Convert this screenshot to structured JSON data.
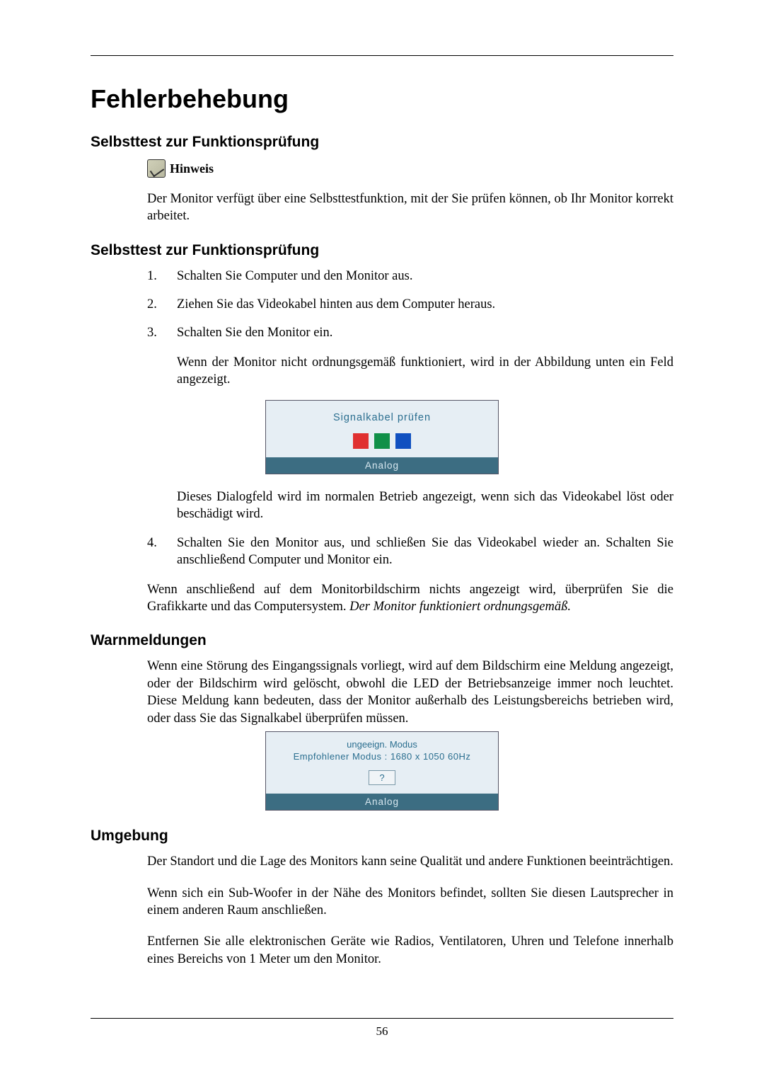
{
  "page_number": "56",
  "title": "Fehlerbehebung",
  "sections": {
    "s1": {
      "heading": "Selbsttest zur Funktionsprüfung",
      "note_label": "Hinweis",
      "note_body": "Der Monitor verfügt über eine Selbsttestfunktion, mit der Sie prüfen können, ob Ihr Monitor korrekt arbeitet."
    },
    "s2": {
      "heading": "Selbsttest zur Funktionsprüfung",
      "steps": {
        "n1": "1.",
        "t1": "Schalten Sie Computer und den Monitor aus.",
        "n2": "2.",
        "t2": "Ziehen Sie das Videokabel hinten aus dem Computer heraus.",
        "n3": "3.",
        "t3": "Schalten Sie den Monitor ein.",
        "p3a": "Wenn der Monitor nicht ordnungsgemäß funktioniert, wird in der Abbildung unten ein Feld angezeigt.",
        "p3b": "Dieses Dialogfeld wird im normalen Betrieb angezeigt, wenn sich das Videokabel löst oder beschädigt wird.",
        "n4": "4.",
        "t4": "Schalten Sie den Monitor aus, und schließen Sie das Videokabel wieder an. Schalten Sie anschließend Computer und Monitor ein."
      },
      "closing_plain": "Wenn anschließend auf dem Monitorbildschirm nichts angezeigt wird, überprüfen Sie die Grafikkarte und das Computersystem. ",
      "closing_italic": "Der Monitor funktioniert ordnungsgemäß."
    },
    "s3": {
      "heading": "Warnmeldungen",
      "body": "Wenn eine Störung des Eingangssignals vorliegt, wird auf dem Bildschirm eine Meldung angezeigt, oder der Bildschirm wird gelöscht, obwohl die LED der Betriebsanzeige immer noch leuchtet. Diese Meldung kann bedeuten, dass der Monitor außerhalb des Leistungsbereichs betrieben wird, oder dass Sie das Signalkabel überprüfen müssen."
    },
    "s4": {
      "heading": "Umgebung",
      "p1": "Der Standort und die Lage des Monitors kann seine Qualität und andere Funktionen beeinträchtigen.",
      "p2": "Wenn sich ein Sub-Woofer in der Nähe des Monitors befindet, sollten Sie diesen Lautsprecher in einem anderen Raum anschließen.",
      "p3": "Entfernen Sie alle elektronischen Geräte wie Radios, Ventilatoren, Uhren und Telefone innerhalb eines Bereichs von 1 Meter um den Monitor."
    }
  },
  "osd1": {
    "message": "Signalkabel prüfen",
    "footer": "Analog"
  },
  "osd2": {
    "line1": "ungeeign. Modus",
    "line2": "Empfohlener Modus : 1680 x 1050  60Hz",
    "button": "?",
    "footer": "Analog"
  }
}
